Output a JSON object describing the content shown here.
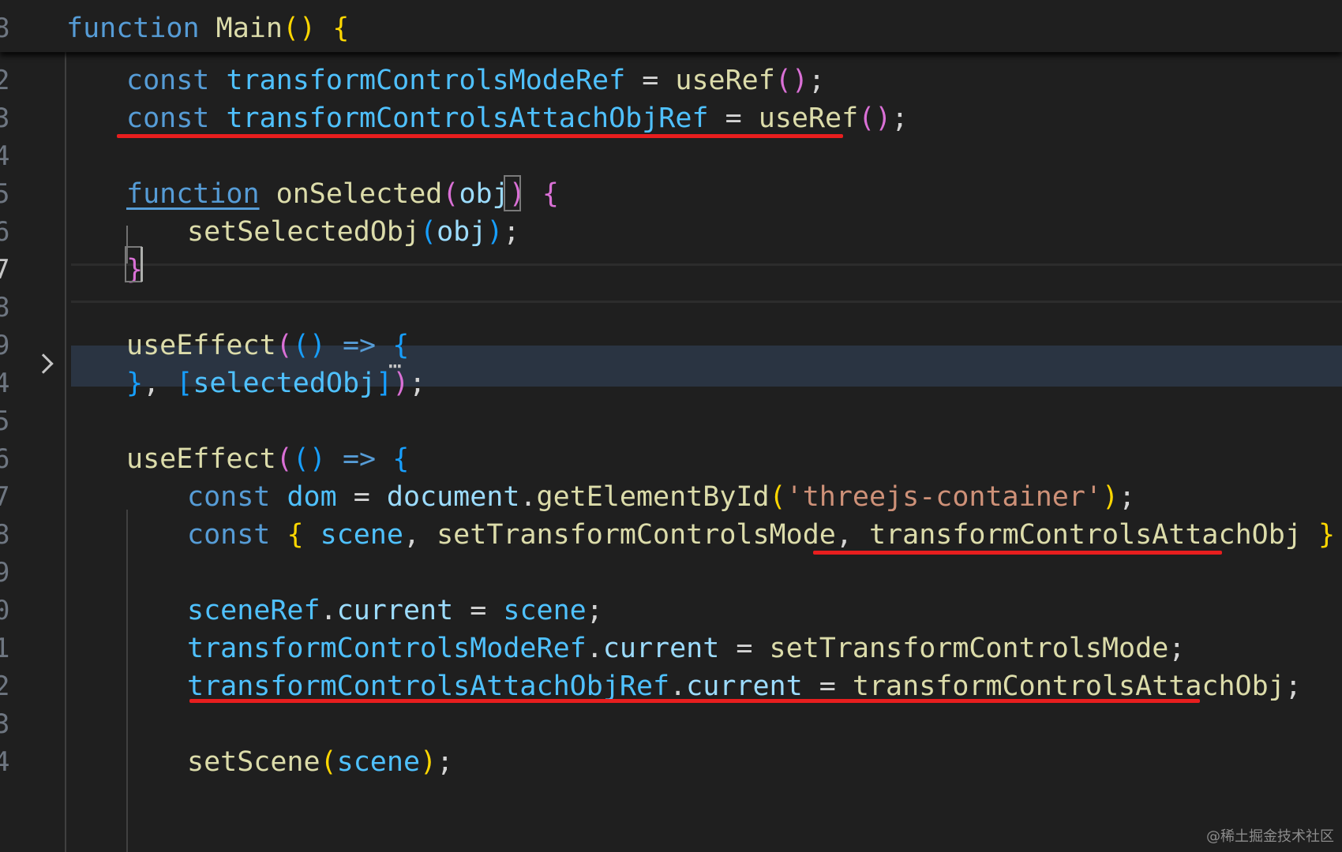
{
  "editor": {
    "sticky_line": {
      "number": "8",
      "code": "function Main() {"
    },
    "lines": [
      {
        "number": "2",
        "code": "const transformControlsModeRef = useRef();"
      },
      {
        "number": "3",
        "code": "const transformControlsAttachObjRef = useRef();"
      },
      {
        "number": "4",
        "code": ""
      },
      {
        "number": "5",
        "code": "function onSelected(obj) {"
      },
      {
        "number": "6",
        "code": "setSelectedObj(obj);"
      },
      {
        "number": "7",
        "code": "}"
      },
      {
        "number": "8",
        "code": ""
      },
      {
        "number": "9",
        "code": "useEffect(() => {…"
      },
      {
        "number": "4",
        "code": "}, [selectedObj]);"
      },
      {
        "number": "5",
        "code": ""
      },
      {
        "number": "6",
        "code": "useEffect(() => {"
      },
      {
        "number": "7",
        "code": "const dom = document.getElementById('threejs-container');"
      },
      {
        "number": "8",
        "code": "const { scene, setTransformControlsMode, transformControlsAttachObj }"
      },
      {
        "number": "9",
        "code": ""
      },
      {
        "number": "0",
        "code": "sceneRef.current = scene;"
      },
      {
        "number": "1",
        "code": "transformControlsModeRef.current = setTransformControlsMode;"
      },
      {
        "number": "2",
        "code": "transformControlsAttachObjRef.current = transformControlsAttachObj;"
      },
      {
        "number": "3",
        "code": ""
      },
      {
        "number": "4",
        "code": "setScene(scene);"
      }
    ],
    "fold_icon": "chevron-right-icon",
    "fold_ellipsis": "⋯",
    "highlight_color": "#e81e1e"
  },
  "watermark": "@稀土掘金技术社区"
}
